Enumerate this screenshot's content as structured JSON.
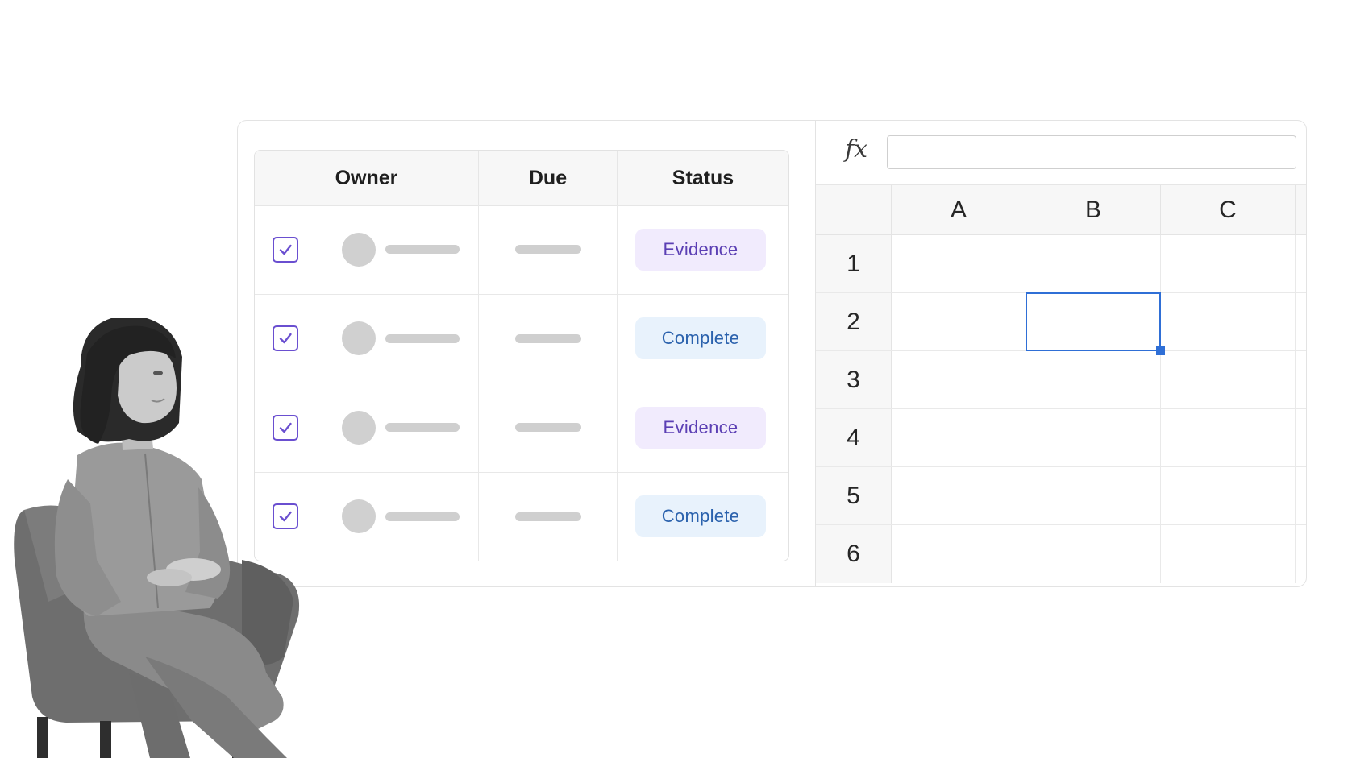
{
  "task_table": {
    "columns": [
      "Owner",
      "Due",
      "Status"
    ],
    "rows": [
      {
        "checked": true,
        "status": "Evidence",
        "status_kind": "evidence"
      },
      {
        "checked": true,
        "status": "Complete",
        "status_kind": "complete"
      },
      {
        "checked": true,
        "status": "Evidence",
        "status_kind": "evidence"
      },
      {
        "checked": true,
        "status": "Complete",
        "status_kind": "complete"
      }
    ]
  },
  "spreadsheet": {
    "formula_icon": "fx",
    "formula_value": "",
    "column_headers": [
      "A",
      "B",
      "C"
    ],
    "row_headers": [
      "1",
      "2",
      "3",
      "4",
      "5",
      "6"
    ],
    "selected_cell": "B2"
  },
  "icons": {
    "check": "checkmark-icon",
    "formula": "function-icon"
  },
  "colors": {
    "accent_purple": "#6a4fd0",
    "evidence_bg": "#f1ebfd",
    "evidence_text": "#5b3fb4",
    "complete_bg": "#e8f2fc",
    "complete_text": "#2b62ad",
    "selection_blue": "#2f6fd6"
  }
}
